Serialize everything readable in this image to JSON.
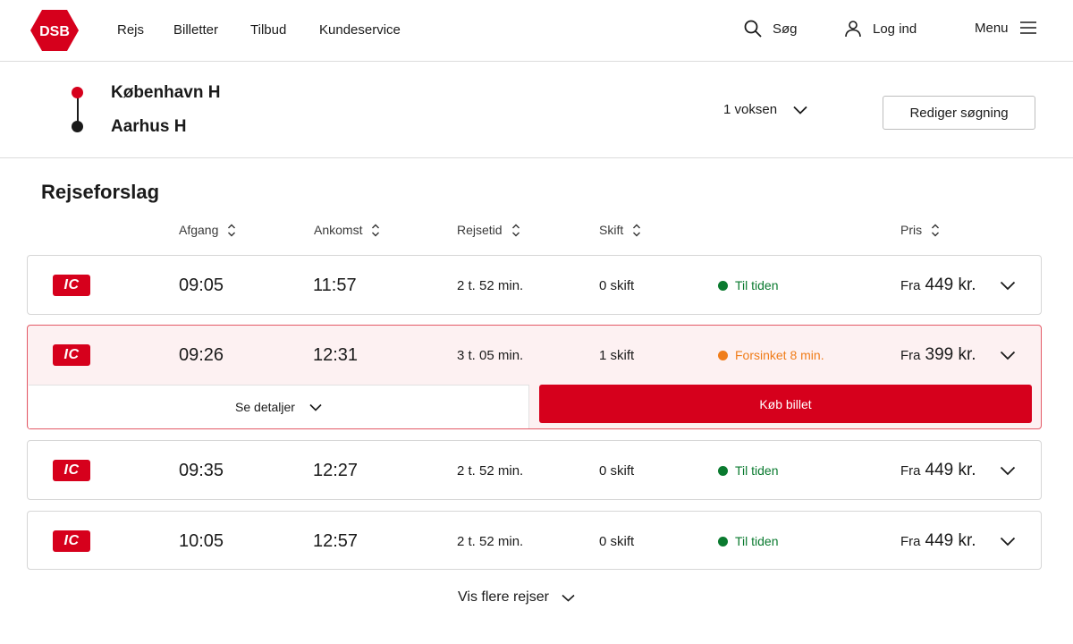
{
  "header": {
    "logo_text": "DSB",
    "nav": [
      "Rejs",
      "Billetter",
      "Tilbud",
      "Kundeservice"
    ],
    "search_label": "Søg",
    "login_label": "Log ind",
    "menu_label": "Menu"
  },
  "search": {
    "from": "København H",
    "to": "Aarhus H",
    "passengers": "1 voksen",
    "edit_label": "Rediger søgning"
  },
  "results": {
    "title": "Rejseforslag",
    "columns": {
      "departure": "Afgang",
      "arrival": "Ankomst",
      "duration": "Rejsetid",
      "changes": "Skift",
      "price": "Pris"
    },
    "trips": [
      {
        "type": "IC",
        "departure": "09:05",
        "arrival": "11:57",
        "duration": "2 t. 52 min.",
        "changes": "0 skift",
        "status": "Til tiden",
        "status_color": "#0a7a2f",
        "price_prefix": "Fra",
        "price": "449 kr."
      },
      {
        "type": "IC",
        "departure": "09:26",
        "arrival": "12:31",
        "duration": "3 t. 05 min.",
        "changes": "1 skift",
        "status": "Forsinket 8 min.",
        "status_color": "#f07d1a",
        "price_prefix": "Fra",
        "price": "399 kr."
      },
      {
        "type": "IC",
        "departure": "09:35",
        "arrival": "12:27",
        "duration": "2 t. 52 min.",
        "changes": "0 skift",
        "status": "Til tiden",
        "status_color": "#0a7a2f",
        "price_prefix": "Fra",
        "price": "449 kr."
      },
      {
        "type": "IC",
        "departure": "10:05",
        "arrival": "12:57",
        "duration": "2 t. 52 min.",
        "changes": "0 skift",
        "status": "Til tiden",
        "status_color": "#0a7a2f",
        "price_prefix": "Fra",
        "price": "449 kr."
      }
    ],
    "details_label": "Se detaljer",
    "buy_label": "Køb billet",
    "more_label": "Vis flere rejser"
  },
  "colors": {
    "brand_red": "#d6001c",
    "on_time_green": "#0a7a2f",
    "delay_orange": "#f07d1a"
  }
}
